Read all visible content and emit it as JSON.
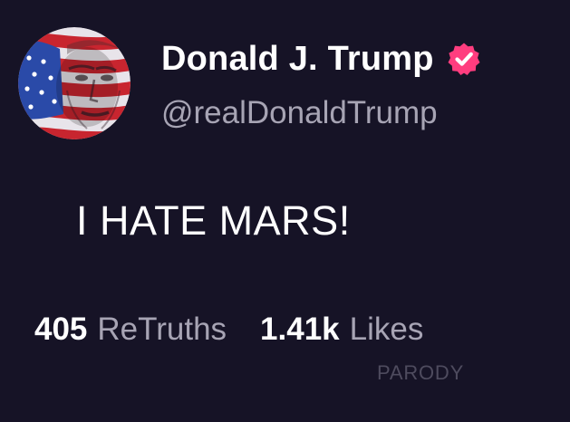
{
  "post": {
    "author": {
      "display_name": "Donald J. Trump",
      "handle": "@realDonaldTrump",
      "verified": true
    },
    "body_text": "I HATE MARS!",
    "stats": {
      "retruths_count": "405",
      "retruths_label": "ReTruths",
      "likes_count": "1.41k",
      "likes_label": "Likes"
    },
    "watermark": "PARODY"
  },
  "colors": {
    "background": "#161326",
    "primary_text": "#ffffff",
    "secondary_text": "#a7a4b4",
    "verified_badge": "#ff3d7f",
    "watermark": "#4e4b5e"
  },
  "icons": {
    "avatar": "flag-face-avatar",
    "verified": "verified-check-icon"
  }
}
